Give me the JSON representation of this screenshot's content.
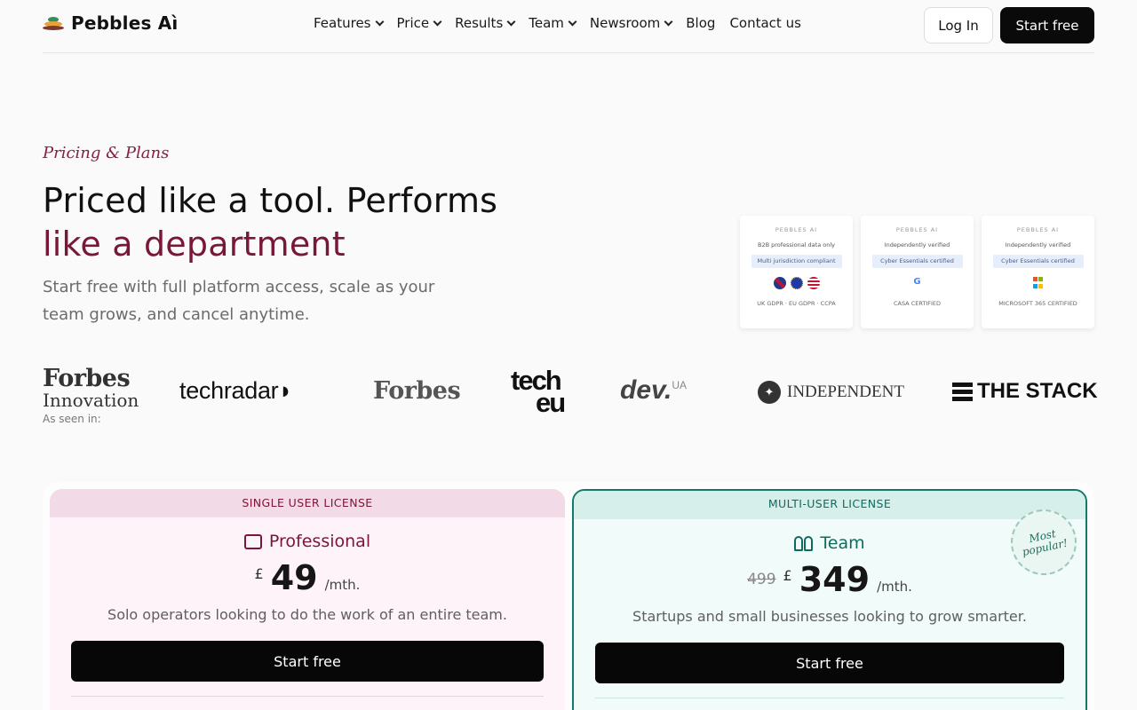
{
  "brand": {
    "name": "Pebbles Aì"
  },
  "nav": {
    "items": [
      {
        "label": "Features",
        "dropdown": true
      },
      {
        "label": "Price",
        "dropdown": true
      },
      {
        "label": "Results",
        "dropdown": true
      },
      {
        "label": "Team",
        "dropdown": true
      },
      {
        "label": "Newsroom",
        "dropdown": true
      },
      {
        "label": "Blog",
        "dropdown": false
      },
      {
        "label": "Contact us",
        "dropdown": false
      }
    ],
    "login_label": "Log In",
    "start_label": "Start free"
  },
  "hero": {
    "eyebrow": "Pricing & Plans",
    "headline_1": "Priced like a tool. Performs",
    "headline_2": "like a department",
    "subtext": "Start free with full platform access, scale as your team grows, and cancel anytime."
  },
  "certs": [
    {
      "brand": "PEBBLES AI",
      "line": "B2B professional data only",
      "badge": "Multi jurisdiction compliant",
      "footer": "UK GDPR · EU GDPR · CCPA"
    },
    {
      "brand": "PEBBLES AI",
      "line": "Independently verified",
      "badge": "Cyber Essentials certified",
      "footer": "CASA CERTIFIED"
    },
    {
      "brand": "PEBBLES AI",
      "line": "Independently verified",
      "badge": "Cyber Essentials certified",
      "footer": "MICROSOFT 365 CERTIFIED"
    }
  ],
  "press": {
    "seen_label": "As seen in:",
    "forbes_innovation_1": "Forbes",
    "forbes_innovation_2": "Innovation",
    "techradar": "techradar",
    "forbes": "Forbes",
    "techeu_1": "tech",
    "techeu_2": "eu",
    "dev": "dev.",
    "dev_sup": "UA",
    "independent": "INDEPENDENT",
    "thestack": "THE STACK"
  },
  "plans": {
    "pro": {
      "band": "SINGLE USER LICENSE",
      "name": "Professional",
      "currency": "£",
      "amount": "49",
      "period": "/mth.",
      "description": "Solo operators looking to do the work of an entire team.",
      "cta": "Start free"
    },
    "team": {
      "band": "MULTI-USER LICENSE",
      "name": "Team",
      "old_price": "499",
      "currency": "£",
      "amount": "349",
      "period": "/mth.",
      "description": "Startups and small businesses looking to grow smarter.",
      "cta": "Start free",
      "badge_1": "Most",
      "badge_2": "popular!"
    }
  },
  "colors": {
    "accent_maroon": "#7a1638",
    "accent_teal": "#0f6b5e",
    "dark": "#0a0a0a"
  }
}
